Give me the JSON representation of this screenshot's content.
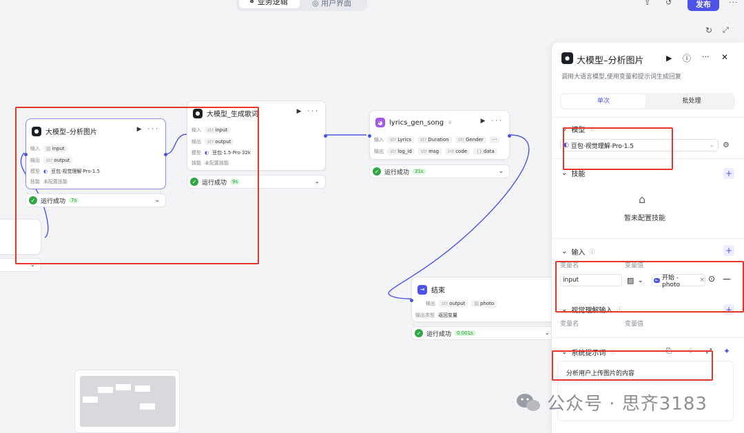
{
  "topbar": {
    "tab_logic": "业务逻辑",
    "tab_ui": "用户界面",
    "publish": "发布"
  },
  "node1": {
    "title": "大模型–分析图片",
    "in_label": "输入",
    "in_type": "",
    "in_name": "input",
    "out_label": "输出",
    "out_type": "str",
    "out_name": "output",
    "model_label": "模型",
    "model": "豆包·视觉理解·Pro·1.5",
    "skill_label": "技能",
    "skill": "未配置技能",
    "status": "运行成功",
    "time": "7s"
  },
  "node2": {
    "title": "大模型_生成歌词",
    "in_label": "输入",
    "in_type": "str",
    "in_name": "input",
    "out_label": "输出",
    "out_type": "str",
    "out_name": "output",
    "model_label": "模型",
    "model": "豆包·1.5·Pro·32k",
    "skill_label": "技能",
    "skill": "未配置技能",
    "status": "运行成功",
    "time": "9s"
  },
  "node3": {
    "title": "lyrics_gen_song",
    "in_label": "输入",
    "in1_type": "str",
    "in1": "Lyrics",
    "in2_type": "str",
    "in2": "Duration",
    "in3_type": "str",
    "in3": "Gender",
    "out_label": "输出",
    "o1_type": "str",
    "o1": "log_id",
    "o2_type": "str",
    "o2": "msg",
    "o3_type": "int",
    "o3": "code",
    "o4_type": "{}",
    "o4": "data",
    "status": "运行成功",
    "time": "31s"
  },
  "node_end": {
    "title": "结束",
    "out_label": "输出",
    "o1_type": "str",
    "o1": "output",
    "o2": "photo",
    "type_label": "输出类型",
    "type_value": "返回变量",
    "status": "运行成功",
    "time": "0.001s"
  },
  "panel": {
    "title": "大模型–分析图片",
    "desc": "调用大语言模型,使用变量和提示词生成回复",
    "tab_single": "单次",
    "tab_batch": "批处理",
    "sec_model": "模型",
    "model_value": "豆包·视觉理解·Pro·1.5",
    "sec_skill": "技能",
    "skill_empty": "暂未配置技能",
    "sec_input": "输入",
    "col_name": "变量名",
    "col_value": "变量值",
    "input_name": "input",
    "input_ref": "开始 - photo",
    "sec_vision": "视觉理解输入",
    "col_name2": "变量名",
    "col_value2": "变量值",
    "sec_prompt": "系统提示词",
    "prompt": "分析用户上传图片的内容"
  },
  "watermark": {
    "text": "公众号 · 思齐3183"
  }
}
